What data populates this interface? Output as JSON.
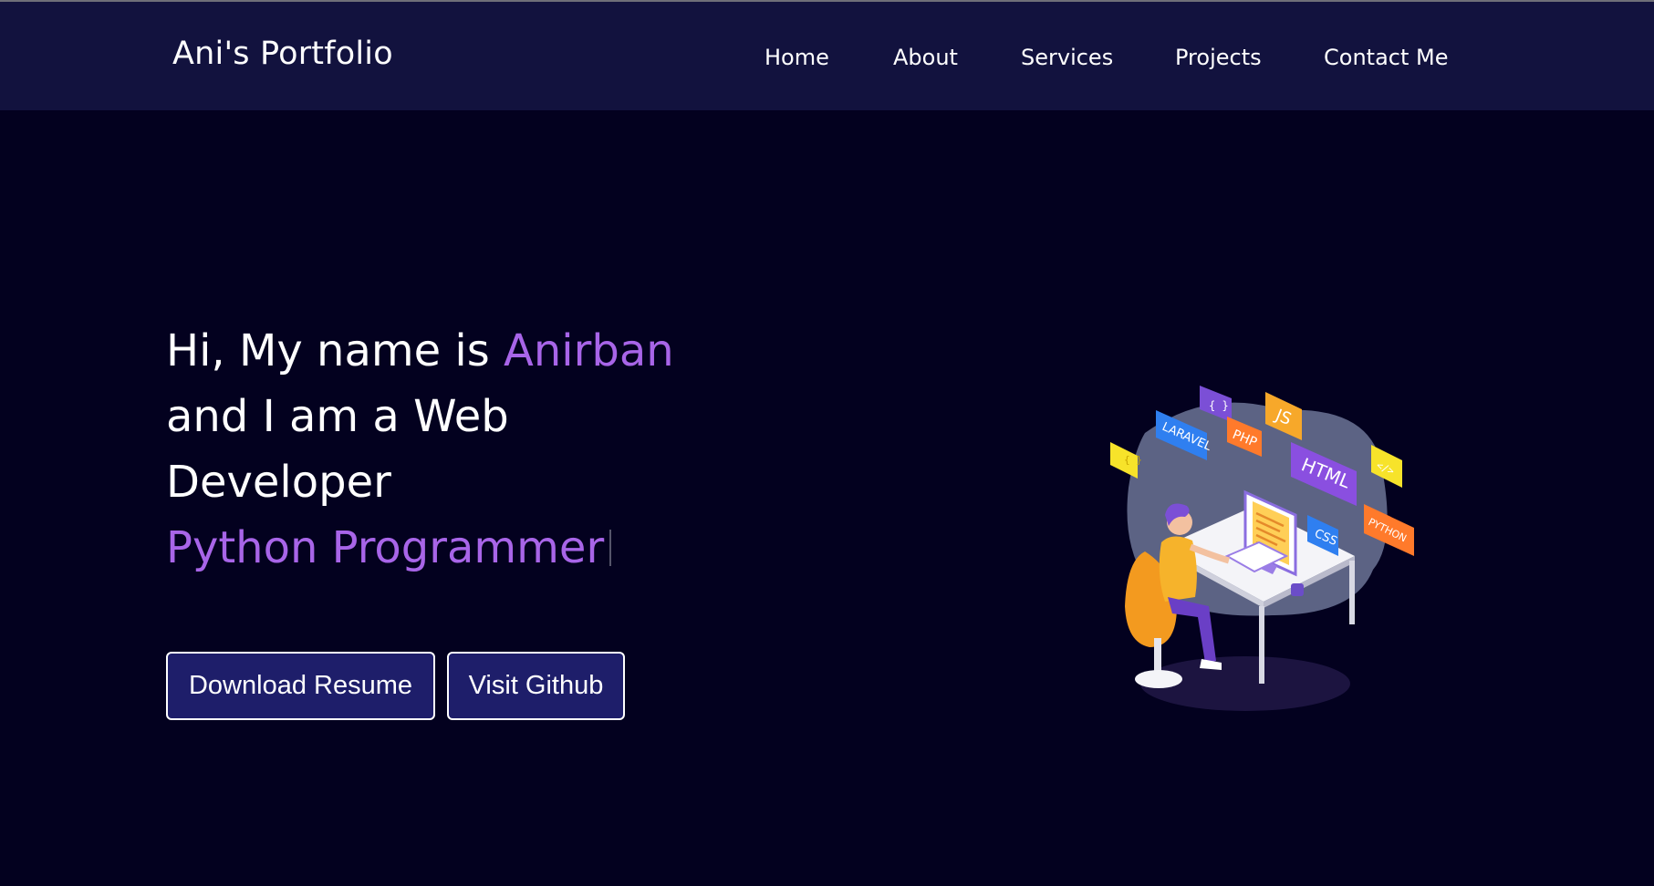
{
  "header": {
    "brand": "Ani's Portfolio",
    "nav": [
      "Home",
      "About",
      "Services",
      "Projects",
      "Contact Me"
    ]
  },
  "hero": {
    "line1_prefix": "Hi, My name is ",
    "line1_name": "Anirban",
    "line2": "and I am a Web",
    "line3": "Developer",
    "typed_text": "Python Programmer"
  },
  "buttons": {
    "download": "Download Resume",
    "github": "Visit Github"
  },
  "illustration": {
    "tags": [
      "{ }",
      "LARAVEL",
      "PHP",
      "JS",
      "HTML",
      "</>",
      "CSS",
      "PYTHON",
      "{ }"
    ]
  },
  "colors": {
    "background": "#03011f",
    "navbar": "#12123e",
    "accent": "#a865e8",
    "button_bg": "#1e1e6a"
  }
}
